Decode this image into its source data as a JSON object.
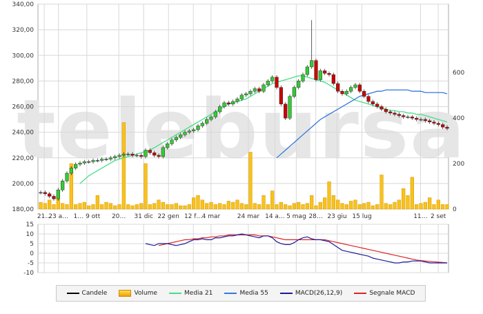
{
  "watermark": "telebursa",
  "chart_data": [
    {
      "type": "candlestick",
      "title": "",
      "y_ticks": [
        "180,00",
        "200,00",
        "220,00",
        "240,00",
        "260,00",
        "280,00",
        "300,00",
        "320,00",
        "340,00"
      ],
      "y_tick_values": [
        180,
        200,
        220,
        240,
        260,
        280,
        300,
        320,
        340
      ],
      "ylim": [
        180,
        340
      ],
      "volume_ticks": [
        "0",
        "200",
        "400",
        "600"
      ],
      "volume_tick_values": [
        0,
        200,
        400,
        600
      ],
      "volume_lim": [
        0,
        900
      ],
      "x_ticks": [
        "21…",
        "23 a…",
        "1… 9 ott",
        "20…",
        "31 dic",
        "22 gen",
        "12 f…",
        "4 mar",
        "24 mar",
        "14 a…",
        "5 mag",
        "28…",
        "23 giu",
        "15 lug",
        "11…",
        "2 set"
      ],
      "x_tick_index": [
        2,
        10,
        26,
        44,
        58,
        72,
        86,
        96,
        117,
        132,
        144,
        155,
        167,
        181,
        214,
        224
      ],
      "n_sessions": 230,
      "close": [
        193,
        192,
        190,
        188,
        195,
        202,
        208,
        212,
        215,
        216,
        217,
        217,
        218,
        218,
        219,
        219,
        220,
        221,
        222,
        223,
        223,
        222,
        222,
        221,
        226,
        224,
        222,
        221,
        228,
        231,
        234,
        236,
        238,
        240,
        241,
        242,
        245,
        247,
        250,
        252,
        256,
        260,
        263,
        262,
        264,
        266,
        269,
        270,
        272,
        274,
        272,
        277,
        280,
        283,
        275,
        262,
        251,
        268,
        275,
        280,
        285,
        291,
        296,
        281,
        288,
        286,
        285,
        278,
        272,
        270,
        272,
        275,
        277,
        272,
        268,
        264,
        262,
        260,
        258,
        256,
        255,
        254,
        253,
        252,
        252,
        251,
        250,
        250,
        249,
        248,
        247,
        246,
        244,
        243
      ],
      "volume": [
        30,
        25,
        40,
        20,
        60,
        25,
        20,
        200,
        20,
        25,
        30,
        15,
        20,
        60,
        20,
        30,
        25,
        15,
        20,
        380,
        20,
        15,
        20,
        25,
        200,
        20,
        25,
        40,
        30,
        20,
        20,
        25,
        15,
        15,
        20,
        50,
        60,
        40,
        25,
        30,
        20,
        25,
        20,
        35,
        30,
        40,
        25,
        20,
        250,
        25,
        20,
        60,
        20,
        80,
        20,
        30,
        20,
        15,
        25,
        30,
        20,
        25,
        60,
        15,
        30,
        50,
        120,
        60,
        40,
        25,
        20,
        35,
        40,
        20,
        25,
        30,
        15,
        20,
        150,
        25,
        20,
        30,
        40,
        90,
        60,
        140,
        20,
        25,
        30,
        50,
        20,
        40,
        20,
        20
      ],
      "ma21": [
        null,
        null,
        null,
        null,
        null,
        null,
        null,
        null,
        null,
        200,
        203,
        206,
        208,
        210,
        212,
        214,
        216,
        218,
        219,
        220,
        221,
        222,
        223,
        224,
        225,
        226,
        228,
        230,
        232,
        234,
        236,
        238,
        240,
        242,
        244,
        246,
        248,
        250,
        252,
        254,
        256,
        258,
        260,
        262,
        263,
        264,
        265,
        266,
        268,
        270,
        272,
        274,
        276,
        278,
        279,
        280,
        281,
        282,
        283,
        284,
        284,
        283,
        282,
        281,
        280,
        279,
        277,
        275,
        273,
        271,
        269,
        267,
        265,
        264,
        263,
        262,
        261,
        260,
        259,
        258,
        257,
        257,
        256,
        256,
        255,
        255,
        254,
        254,
        253,
        252,
        251,
        250,
        249,
        248
      ],
      "ma55": [
        null,
        null,
        null,
        null,
        null,
        null,
        null,
        null,
        null,
        null,
        null,
        null,
        null,
        null,
        null,
        null,
        null,
        null,
        null,
        null,
        null,
        null,
        null,
        null,
        null,
        null,
        null,
        null,
        null,
        null,
        null,
        null,
        null,
        null,
        null,
        null,
        null,
        null,
        null,
        null,
        null,
        null,
        null,
        null,
        null,
        null,
        null,
        null,
        null,
        null,
        null,
        null,
        null,
        null,
        220,
        223,
        226,
        229,
        232,
        235,
        238,
        241,
        244,
        247,
        250,
        252,
        254,
        256,
        258,
        260,
        262,
        264,
        266,
        268,
        269,
        270,
        271,
        272,
        272,
        273,
        273,
        273,
        273,
        273,
        273,
        272,
        272,
        272,
        271,
        271,
        271,
        271,
        271,
        270
      ]
    },
    {
      "type": "line",
      "title": "",
      "y_ticks": [
        "15",
        "10",
        "5",
        "0",
        "-5",
        "-10"
      ],
      "y_tick_values": [
        15,
        10,
        5,
        0,
        -5,
        -10
      ],
      "ylim": [
        -10,
        15
      ],
      "macd": [
        null,
        null,
        null,
        null,
        null,
        null,
        null,
        null,
        null,
        null,
        null,
        null,
        null,
        null,
        null,
        null,
        null,
        null,
        null,
        null,
        null,
        null,
        null,
        null,
        5,
        4.5,
        4,
        5,
        5,
        5,
        4.5,
        4,
        4.5,
        5,
        6,
        7,
        7,
        7.5,
        7,
        7,
        8,
        8,
        8.5,
        9,
        9,
        9.5,
        10,
        9.5,
        9,
        8.5,
        8,
        9,
        9,
        8,
        6,
        5,
        4.5,
        4.5,
        5.5,
        7,
        8,
        8.5,
        7.5,
        7,
        7,
        6.5,
        6,
        4.5,
        3,
        1.5,
        1,
        0.5,
        0,
        -0.5,
        -1,
        -1.5,
        -2.5,
        -3,
        -3.5,
        -4,
        -4.5,
        -5,
        -5,
        -4.5,
        -4.5,
        -4,
        -4,
        -4,
        -4.5,
        -5,
        -5,
        -5,
        -5,
        -5
      ],
      "signal": [
        null,
        null,
        null,
        null,
        null,
        null,
        null,
        null,
        null,
        null,
        null,
        null,
        null,
        null,
        null,
        null,
        null,
        null,
        null,
        null,
        null,
        null,
        null,
        null,
        null,
        null,
        null,
        4,
        4.5,
        5,
        5.5,
        6,
        6.5,
        7,
        7,
        7.5,
        7.5,
        8,
        8,
        8.5,
        8.5,
        9,
        9,
        9.5,
        9.5,
        9.5,
        9.5,
        9.5,
        9.5,
        9.5,
        9,
        9,
        9,
        8.5,
        8,
        7.5,
        7,
        7,
        7,
        7,
        7,
        7,
        7,
        7,
        7,
        7,
        6.5,
        6,
        5.5,
        5,
        4.5,
        4,
        3.5,
        3,
        2.5,
        2,
        1.5,
        1,
        0.5,
        0,
        -0.5,
        -1,
        -1.5,
        -2,
        -2.5,
        -3,
        -3.5,
        -3.8,
        -4,
        -4.2,
        -4.4,
        -4.6,
        -4.8,
        -5
      ]
    }
  ],
  "legend": [
    {
      "label": "Candele",
      "color": "#000000",
      "kind": "line"
    },
    {
      "label": "Volume",
      "color": "#f5b800",
      "kind": "box"
    },
    {
      "label": "Media 21",
      "color": "#44dd88",
      "kind": "line"
    },
    {
      "label": "Media 55",
      "color": "#3377dd",
      "kind": "line"
    },
    {
      "label": "MACD(26,12,9)",
      "color": "#1a1a99",
      "kind": "line"
    },
    {
      "label": "Segnale MACD",
      "color": "#dd2222",
      "kind": "line"
    }
  ],
  "colors": {
    "up": "#33cc33",
    "down": "#cc0000",
    "grid": "#d8d8d8",
    "axis": "#888888",
    "watermark": "#e6e6e6"
  }
}
